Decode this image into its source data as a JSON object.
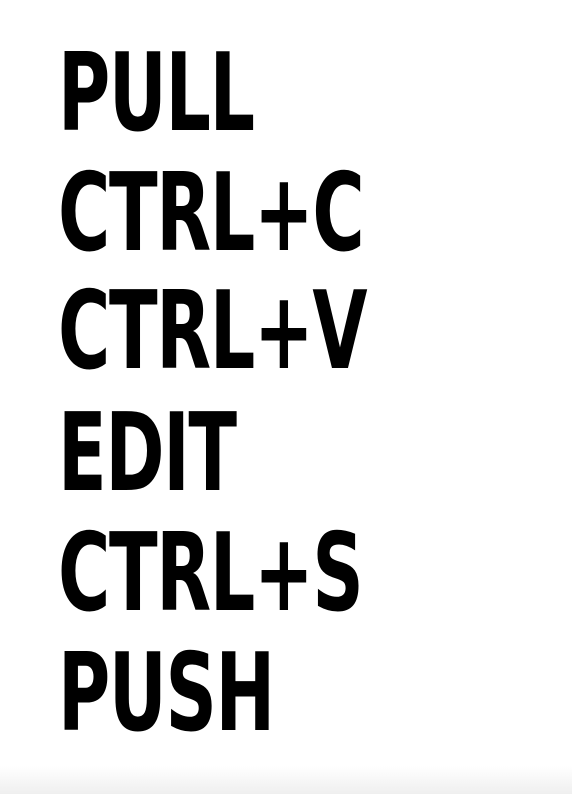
{
  "poster": {
    "lines": [
      "PULL",
      "CTRL+C",
      "CTRL+V",
      "EDIT",
      "CTRL+S",
      "PUSH"
    ],
    "text_color": "#000000",
    "background_color": "#ffffff"
  }
}
